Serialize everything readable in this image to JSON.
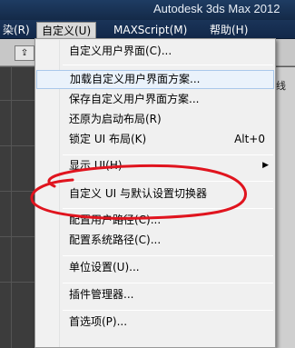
{
  "window": {
    "title": "Autodesk 3ds Max  2012"
  },
  "menubar": {
    "items": [
      "染(R)",
      "自定义(U)",
      "MAXScript(M)",
      "帮助(H)"
    ]
  },
  "side_text": "线",
  "dropdown": {
    "items": [
      {
        "label": "自定义用户界面(C)..."
      },
      {
        "label": "加载自定义用户界面方案..."
      },
      {
        "label": "保存自定义用户界面方案..."
      },
      {
        "label": "还原为启动布局(R)"
      },
      {
        "label": "锁定 UI 布局(K)",
        "shortcut": "Alt+0"
      },
      {
        "label": "显示 UI(H)",
        "submenu": "▶"
      },
      {
        "label": "自定义 UI 与默认设置切换器"
      },
      {
        "label": "配置用户路径(C)..."
      },
      {
        "label": "配置系统路径(C)..."
      },
      {
        "label": "单位设置(U)..."
      },
      {
        "label": "插件管理器..."
      },
      {
        "label": "首选项(P)..."
      }
    ]
  },
  "annotation": {
    "color": "#e0141e"
  },
  "colors": {
    "titlebar": "#1e3c63",
    "menu_hover_border": "#a9c8ea"
  }
}
